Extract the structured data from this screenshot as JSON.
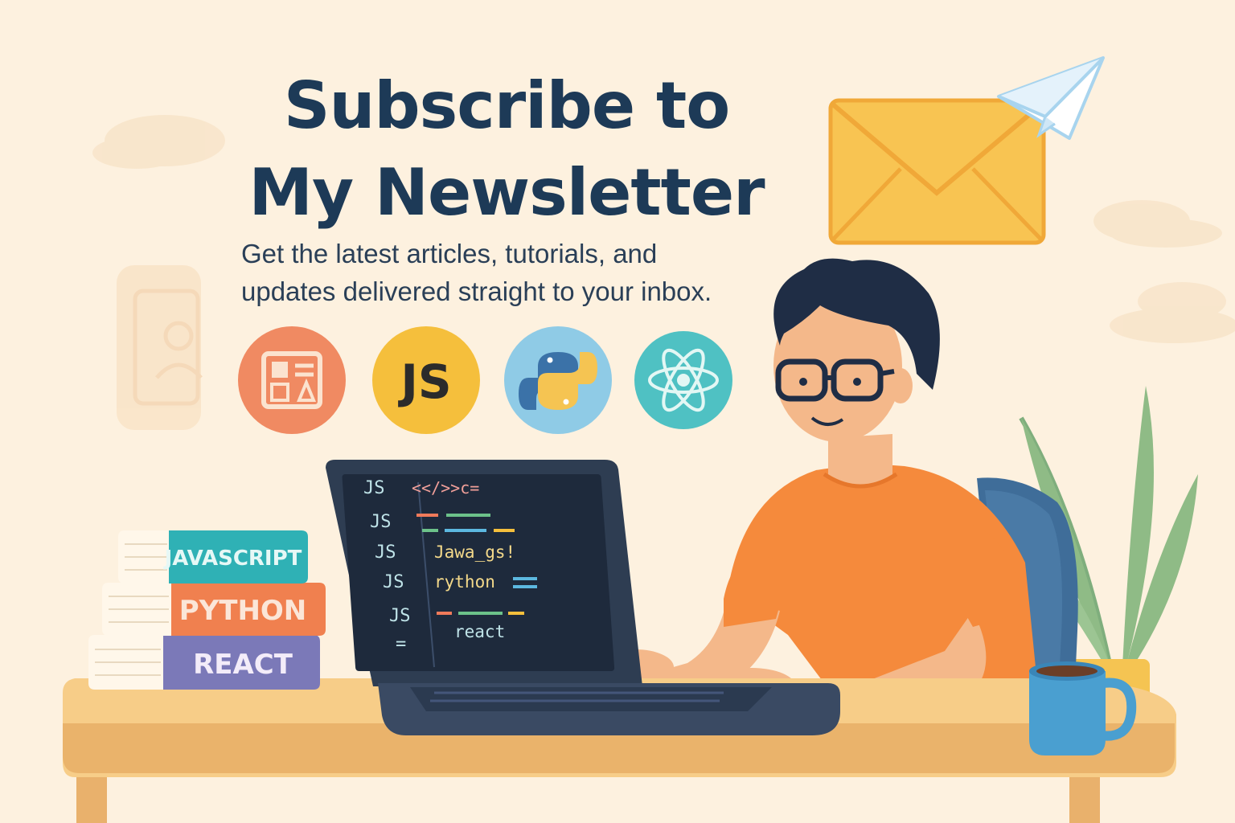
{
  "headline": {
    "line1": "Subscribe to",
    "line2": "My Newsletter"
  },
  "subtitle": {
    "line1": "Get the latest articles, tutorials, and",
    "line2": "updates delivered straight to your inbox."
  },
  "topic_icons": [
    {
      "name": "layout-icon",
      "label": "",
      "color": "#f08a62"
    },
    {
      "name": "javascript-icon",
      "label": "JS",
      "color": "#f5bf3c"
    },
    {
      "name": "python-icon",
      "label": "",
      "color": "#8fcbe6"
    },
    {
      "name": "react-icon",
      "label": "",
      "color": "#4fc1c3"
    }
  ],
  "books": [
    {
      "label": "JAVASCRIPT",
      "color": "#2fb1b5"
    },
    {
      "label": "PYTHON",
      "color": "#f0804f"
    },
    {
      "label": "REACT",
      "color": "#7b79b8"
    }
  ],
  "code_screen": {
    "gutter": [
      "JS",
      "JS",
      "JS",
      "JS",
      "JS",
      "="
    ],
    "lines": [
      "<</>>c=",
      "",
      "",
      "Jawa_gs!",
      "rython",
      "",
      "react"
    ]
  },
  "colors": {
    "background": "#fdf1df",
    "headline": "#1d3a57",
    "shirt": "#f58a3c",
    "envelope": "#f8c452"
  }
}
